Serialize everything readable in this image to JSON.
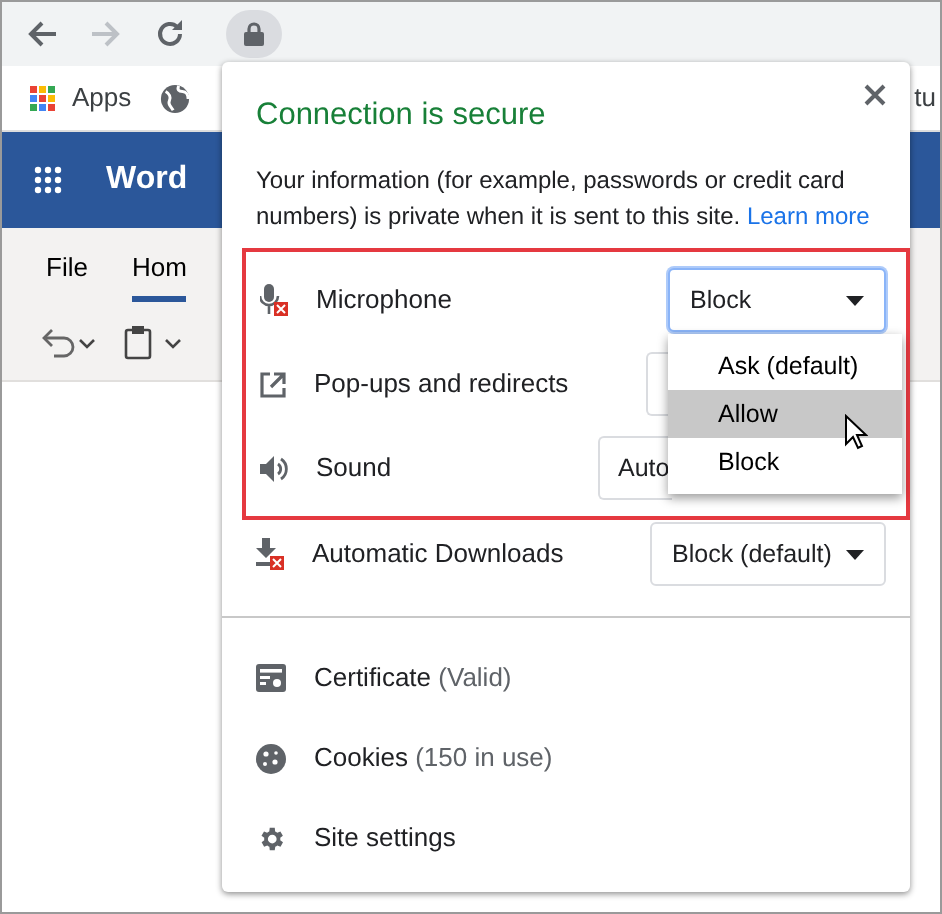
{
  "bookmarks": [
    {
      "kind": "apps",
      "label": "Apps"
    },
    {
      "kind": "globe"
    },
    {
      "kind": "text",
      "label": "tu"
    }
  ],
  "app": {
    "name": "Word"
  },
  "ribbon_tabs": [
    {
      "label": "File",
      "selected": false
    },
    {
      "label": "Hom",
      "selected": true
    }
  ],
  "popup": {
    "title": "Connection is secure",
    "description": "Your information (for example, passwords or credit card numbers) is private when it is sent to this site.",
    "link": "Learn more",
    "highlight_frame": {
      "permissions": [
        {
          "kind": "microphone",
          "label": "Microphone",
          "value": "Block",
          "focused": true
        },
        {
          "kind": "popups",
          "label": "Pop-ups and redirects",
          "focused": false
        },
        {
          "kind": "sound",
          "label": "Sound",
          "value": "Auto",
          "focused": false
        }
      ]
    },
    "permissions": [
      {
        "kind": "downloads",
        "label": "Automatic Downloads",
        "value": "Block (default)",
        "focused": false
      }
    ],
    "menu": [
      {
        "label": "Ask (default)",
        "selected": false
      },
      {
        "label": "Allow",
        "selected": true
      },
      {
        "label": "Block",
        "selected": false
      }
    ],
    "info": [
      {
        "kind": "certificate",
        "label": "Certificate",
        "detail": "(Valid)"
      },
      {
        "kind": "cookies",
        "label": "Cookies",
        "detail": "(150 in use)"
      },
      {
        "kind": "settings",
        "label": "Site settings"
      }
    ]
  }
}
